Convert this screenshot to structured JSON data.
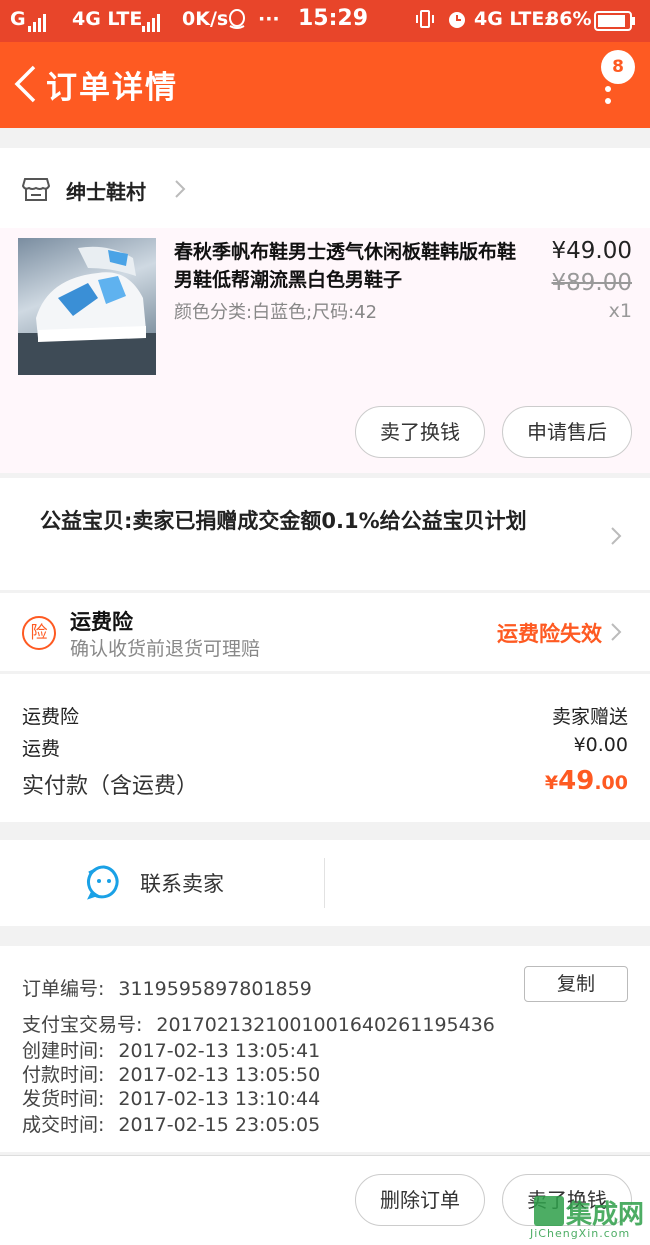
{
  "status_bar": {
    "carrier_left": "G",
    "network": "4G LTE",
    "speed": "0K/s",
    "dots": "···",
    "time": "15:29",
    "network_right": "4G LTE₂",
    "battery": "86%"
  },
  "header": {
    "title": "订单详情",
    "badge_count": "8"
  },
  "shop": {
    "name": "绅士鞋村"
  },
  "product": {
    "title": "春秋季帆布鞋男士透气休闲板鞋韩版布鞋男鞋低帮潮流黑白色男鞋子",
    "spec": "颜色分类:白蓝色;尺码:42",
    "price": "¥49.00",
    "original_price": "¥89.00",
    "quantity": "x1",
    "actions": [
      "卖了换钱",
      "申请售后"
    ]
  },
  "charity": {
    "text": "公益宝贝:卖家已捐赠成交金额0.1%给公益宝贝计划"
  },
  "insurance": {
    "icon_char": "险",
    "title": "运费险",
    "subtitle": "确认收货前退货可理赔",
    "status": "运费险失效"
  },
  "cost": {
    "rows": [
      {
        "label": "运费险",
        "value": "卖家赠送"
      },
      {
        "label": "运费",
        "value": "¥0.00"
      }
    ],
    "total_label": "实付款（含运费）",
    "total_currency": "¥",
    "total_integer": "49",
    "total_decimal": ".00"
  },
  "contact": {
    "label": "联系卖家"
  },
  "order_info": {
    "copy_label": "复制",
    "rows": [
      {
        "label": "订单编号:",
        "value": "3119595897801859"
      },
      {
        "label": "支付宝交易号:",
        "value": "2017021321001001640261195436"
      },
      {
        "label": "创建时间:",
        "value": "2017-02-13 13:05:41"
      },
      {
        "label": "付款时间:",
        "value": "2017-02-13 13:05:50"
      },
      {
        "label": "发货时间:",
        "value": "2017-02-13 13:10:44"
      },
      {
        "label": "成交时间:",
        "value": "2017-02-15 23:05:05"
      }
    ]
  },
  "bottom_actions": [
    "删除订单",
    "卖了换钱"
  ],
  "watermark": {
    "text": "集成网",
    "sub": "JiChengXin.com"
  },
  "colors": {
    "accent": "#fe5a22",
    "status_bar": "#e8452a"
  }
}
